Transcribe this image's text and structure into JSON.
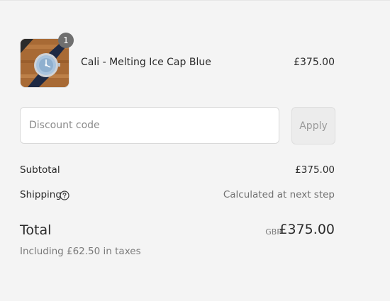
{
  "order": {
    "items": [
      {
        "name": "Cali - Melting Ice Cap Blue",
        "price": "£375.00",
        "quantity": "1",
        "image": "watch-product-thumbnail"
      }
    ]
  },
  "discount": {
    "placeholder": "Discount code",
    "value": "",
    "apply_label": "Apply"
  },
  "summary": {
    "subtotal_label": "Subtotal",
    "subtotal_value": "£375.00",
    "shipping_label": "Shipping",
    "shipping_icon": "help-circle-icon",
    "shipping_value": "Calculated at next step",
    "total_label": "Total",
    "currency": "GBP",
    "total_value": "£375.00",
    "taxes_note": "Including £62.50 in taxes"
  },
  "colors": {
    "background": "#f4f4f4",
    "badge": "#6f6f6f",
    "muted_text": "#7a7a7a",
    "button_bg": "#ececec"
  }
}
